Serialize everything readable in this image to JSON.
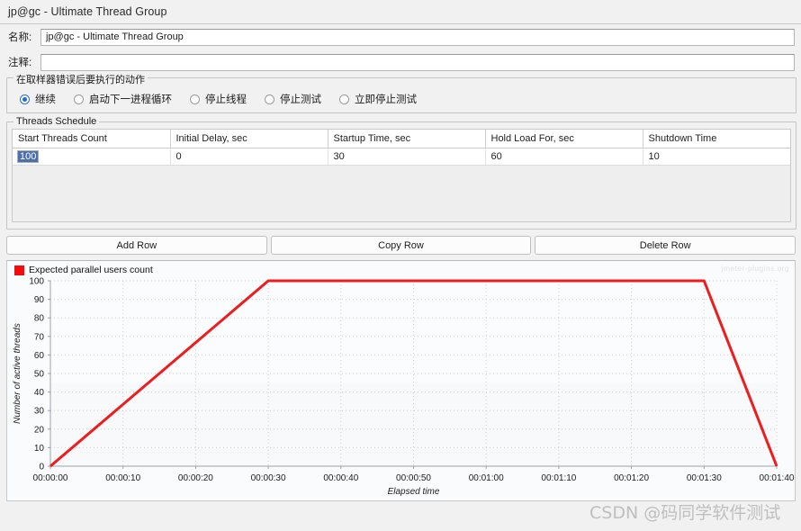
{
  "window": {
    "title": "jp@gc - Ultimate Thread Group"
  },
  "form": {
    "name_label": "名称:",
    "name_value": "jp@gc - Ultimate Thread Group",
    "comment_label": "注释:",
    "comment_value": "",
    "comment_placeholder": ""
  },
  "error_action": {
    "group_title": "在取样器错误后要执行的动作",
    "options": [
      {
        "label": "继续",
        "checked": true
      },
      {
        "label": "启动下一进程循环",
        "checked": false
      },
      {
        "label": "停止线程",
        "checked": false
      },
      {
        "label": "停止测试",
        "checked": false
      },
      {
        "label": "立即停止测试",
        "checked": false
      }
    ]
  },
  "schedule": {
    "group_title": "Threads Schedule",
    "columns": [
      "Start Threads Count",
      "Initial Delay, sec",
      "Startup Time, sec",
      "Hold Load For, sec",
      "Shutdown Time"
    ],
    "rows": [
      {
        "start_threads_count": "100",
        "initial_delay": "0",
        "startup_time": "30",
        "hold_load_for": "60",
        "shutdown_time": "10",
        "selected_cell": 0
      }
    ]
  },
  "buttons": {
    "add_row": "Add Row",
    "copy_row": "Copy Row",
    "delete_row": "Delete Row"
  },
  "chart_data": {
    "type": "line",
    "title": "",
    "legend": [
      "Expected parallel users count"
    ],
    "legend_position": "top-left",
    "series": [
      {
        "name": "Expected parallel users count",
        "color": "#ee1c1c",
        "x": [
          0,
          30,
          90,
          100
        ],
        "values": [
          0,
          100,
          100,
          0
        ]
      }
    ],
    "xlabel": "Elapsed time",
    "ylabel": "Number of active threads",
    "xlim": [
      0,
      100
    ],
    "ylim": [
      0,
      100
    ],
    "x_tick_values": [
      0,
      10,
      20,
      30,
      40,
      50,
      60,
      70,
      80,
      90,
      100
    ],
    "x_tick_labels": [
      "00:00:00",
      "00:00:10",
      "00:00:20",
      "00:00:30",
      "00:00:40",
      "00:00:50",
      "00:01:00",
      "00:01:10",
      "00:01:20",
      "00:01:30",
      "00:01:40"
    ],
    "y_tick_values": [
      0,
      10,
      20,
      30,
      40,
      50,
      60,
      70,
      80,
      90,
      100
    ],
    "y_tick_labels": [
      "0",
      "10",
      "20",
      "30",
      "40",
      "50",
      "60",
      "70",
      "80",
      "90",
      "100"
    ],
    "grid": true,
    "watermark": "jmeter-plugins.org",
    "overlay_watermark": "CSDN @码同学软件测试"
  }
}
